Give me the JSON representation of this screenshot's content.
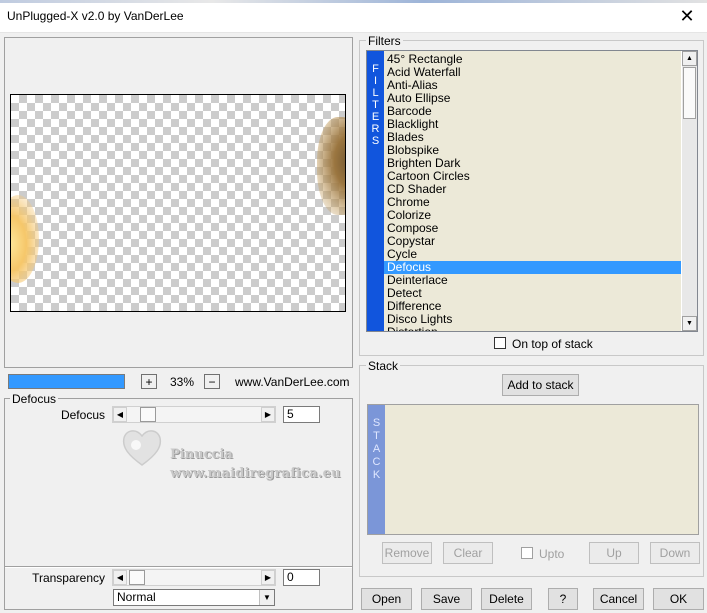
{
  "window": {
    "title": "UnPlugged-X v2.0 by VanDerLee",
    "close_glyph": "✕"
  },
  "preview": {
    "zoom_in_label": "+",
    "zoom_out_label": "−",
    "zoom_level": "33%",
    "website": "www.VanDerLee.com",
    "progress": 1.0,
    "progress_color": "#3399ff"
  },
  "params": {
    "group_label": "Defocus",
    "defocus": {
      "label": "Defocus",
      "value": "5"
    },
    "transparency": {
      "label": "Transparency",
      "value": "0"
    },
    "blend_mode": "Normal"
  },
  "watermark": {
    "name": "Pinuccia",
    "site": "www.maidiregrafica.eu"
  },
  "filters": {
    "group_label": "Filters",
    "side_letters": [
      "F",
      "I",
      "L",
      "T",
      "E",
      "R",
      "S"
    ],
    "side_color": "#1155dd",
    "items": [
      "45° Rectangle",
      "Acid Waterfall",
      "Anti-Alias",
      "Auto Ellipse",
      "Barcode",
      "Blacklight",
      "Blades",
      "Blobspike",
      "Brighten Dark",
      "Cartoon Circles",
      "CD Shader",
      "Chrome",
      "Colorize",
      "Compose",
      "Copystar",
      "Cycle",
      "Defocus",
      "Deinterlace",
      "Detect",
      "Difference",
      "Disco Lights",
      "Distortion"
    ],
    "selected": "Defocus",
    "selection_color": "#3399ff",
    "on_top_label": "On top of stack",
    "on_top_checked": false
  },
  "stack": {
    "group_label": "Stack",
    "add_label": "Add to stack",
    "side_letters": [
      "S",
      "T",
      "A",
      "C",
      "K"
    ],
    "side_color": "#7b96d8",
    "remove_label": "Remove",
    "clear_label": "Clear",
    "upto_label": "Upto",
    "up_label": "Up",
    "down_label": "Down"
  },
  "footer": {
    "open_label": "Open",
    "save_label": "Save",
    "delete_label": "Delete",
    "help_label": "?",
    "cancel_label": "Cancel",
    "ok_label": "OK"
  }
}
